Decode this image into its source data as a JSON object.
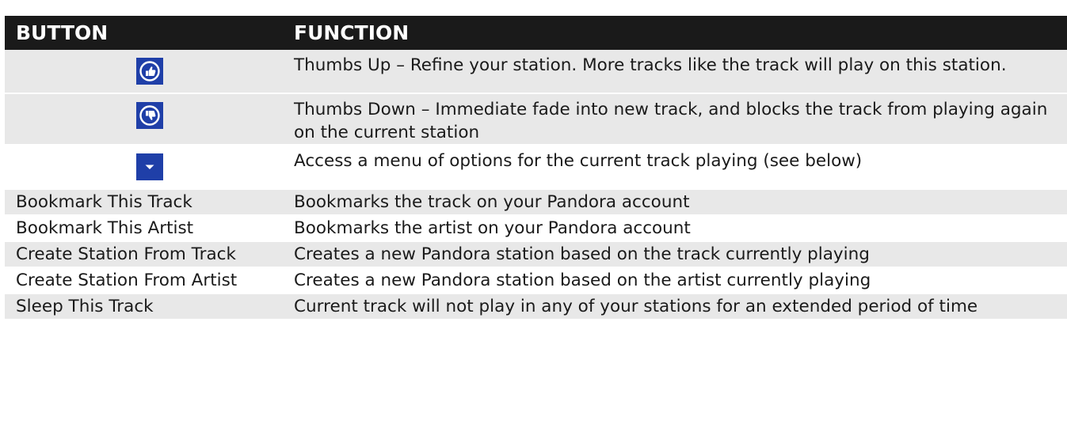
{
  "header": {
    "col_button": "BUTTON",
    "col_function": "FUNCTION"
  },
  "icon_rows": [
    {
      "icon": "thumbs-up-icon",
      "function": "Thumbs Up – Refine your station. More tracks like the track will play on this station."
    },
    {
      "icon": "thumbs-down-icon",
      "function": "Thumbs Down – Immediate fade into new track, and blocks the track from playing again on the current station"
    },
    {
      "icon": "dropdown-arrow-icon",
      "function": "Access a menu of options for the current track playing (see below)"
    }
  ],
  "text_rows": [
    {
      "button": "Bookmark This Track",
      "function": "Bookmarks the track on your Pandora account"
    },
    {
      "button": "Bookmark This Artist",
      "function": "Bookmarks the artist on your Pandora account"
    },
    {
      "button": "Create Station From Track",
      "function": "Creates a new Pandora station based on the track currently playing"
    },
    {
      "button": "Create Station From Artist",
      "function": "Creates a new Pandora station based on the artist currently playing"
    },
    {
      "button": "Sleep This Track",
      "function": "Current track will not play in any of your stations for an extended period of time"
    }
  ],
  "colors": {
    "header_bg": "#1a1a1a",
    "row_shade": "#e8e8e8",
    "icon_bg": "#1f3fa8"
  }
}
